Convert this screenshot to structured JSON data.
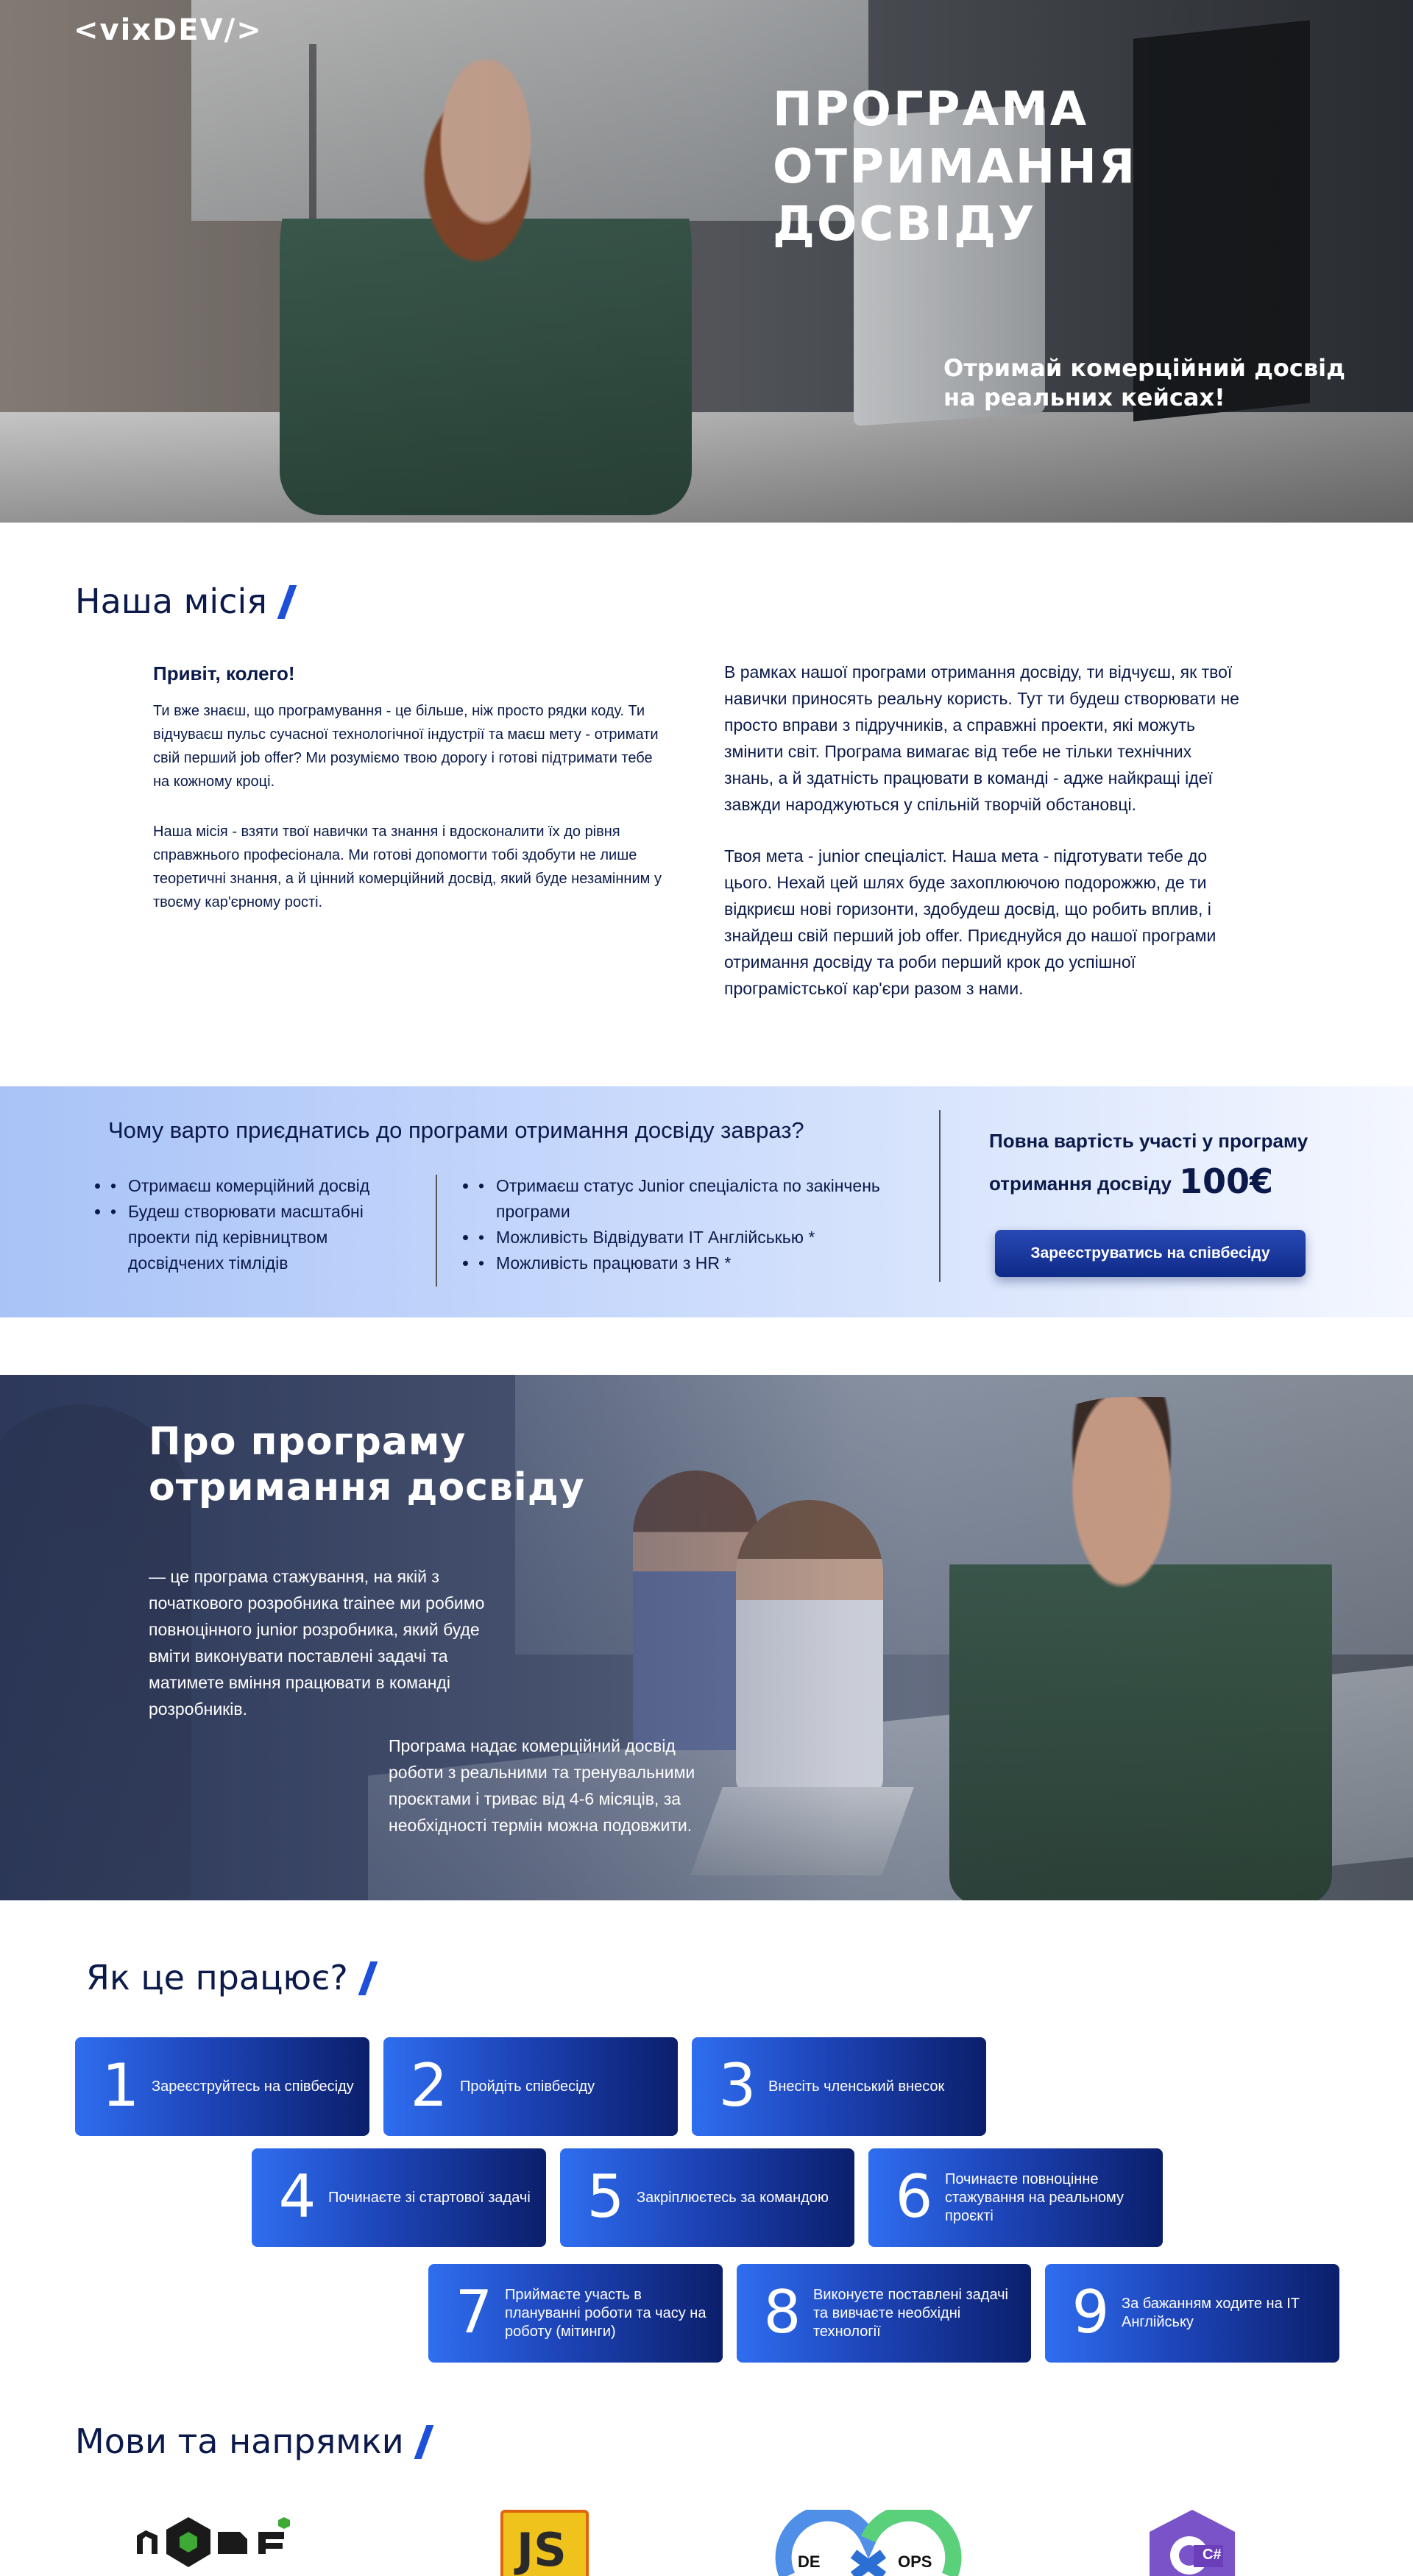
{
  "brand": {
    "logo": "<vixDEV/>"
  },
  "hero": {
    "title": "ПРОГРАМА ОТРИМАННЯ ДОСВІДУ",
    "subtitle": "Отримай комерційний досвід на реальних кейсах!"
  },
  "mission": {
    "title": "Наша місія",
    "greeting": "Привіт, колего!",
    "left_paragraphs": [
      "Ти вже знаєш, що програмування - це більше, ніж просто рядки коду. Ти відчуваєш пульс сучасної технологічної індустрії та маєш мету - отримати свій перший job offer? Ми розуміємо твою дорогу і готові підтримати тебе на кожному кроці.",
      "Наша місія - взяти твої навички та знання і вдосконалити їх до рівня справжнього професіонала. Ми готові допомогти тобі здобути не лише теоретичні знання, а й цінний комерційний досвід, який буде незамінним у твоєму кар'єрному рості."
    ],
    "right_paragraphs": [
      "В рамках нашої програми отримання досвіду, ти відчуєш, як твої навички приносять реальну користь. Тут ти будеш створювати не просто вправи з підручників, а справжні проекти, які можуть змінити світ. Програма вимагає від тебе не тільки технічних знань, а й здатність працювати в команді - адже найкращі ідеї завжди народжуються у спільній творчій обстановці.",
      "Твоя мета - junior спеціаліст. Наша мета - підготувати тебе до цього. Нехай цей шлях буде захоплюючою подорожжю, де ти відкриєш нові горизонти, здобудеш досвід, що робить вплив, і знайдеш свій перший job offer. Приєднуйся до нашої програми отримання досвіду та роби перший крок до успішної програмістської кар'єри разом з нами."
    ]
  },
  "why": {
    "title": "Чому варто приєднатись до програми отримання досвіду завраз?",
    "left_items": [
      "Отримаєш комерційний досвід",
      "Будеш створювати масштабні проекти під керівництвом досвідчених тімлідів"
    ],
    "right_items": [
      "Отримаєш статус Junior спеціаліста по закінчень програми",
      "Можливість Відвідувати IT Англійськью *",
      "Можливість працювати з HR *"
    ],
    "price_label": "Повна вартість участі у програму отримання досвіду",
    "price_value": "100€",
    "cta": "Зареєструватись на співбесіду"
  },
  "about": {
    "title": "Про програму отримання досвіду",
    "p1": "— це програма стажування, на якій з початкового розробника trainee ми робимо повноцінного junior розробника, який буде вміти виконувати поставлені задачі та матимете вміння працювати в команді розробників.",
    "p2": "Програма надає комерційний досвід роботи з реальними та тренувальними проєктами і триває від 4-6 місяців, за необхідності термін можна подовжити."
  },
  "how": {
    "title": "Як це працює?",
    "steps": [
      {
        "n": "1",
        "text": "Зареєструйтесь на співбесіду"
      },
      {
        "n": "2",
        "text": "Пройдіть співбесіду"
      },
      {
        "n": "3",
        "text": "Внесіть членський внесок"
      },
      {
        "n": "4",
        "text": "Починаєте зі стартової задачі"
      },
      {
        "n": "5",
        "text": "Закріплюєтесь за командою"
      },
      {
        "n": "6",
        "text": "Починаєте повноцінне стажування на реальному проєкті"
      },
      {
        "n": "7",
        "text": "Приймаєте участь в плануванні роботи та часу на роботу (мітинги)"
      },
      {
        "n": "8",
        "text": "Виконуєте поставлені задачі та вивчаєте необхідні технології"
      },
      {
        "n": "9",
        "text": "За бажанням ходите на IT Англійську"
      }
    ]
  },
  "languages": {
    "title": "Мови та напрямки",
    "icons": [
      "nodejs-icon",
      "javascript-icon",
      "devops-icon",
      "csharp-icon"
    ],
    "js_label": "JS",
    "devops_left": "DE",
    "devops_right": "OPS",
    "csharp_label": "C#"
  }
}
